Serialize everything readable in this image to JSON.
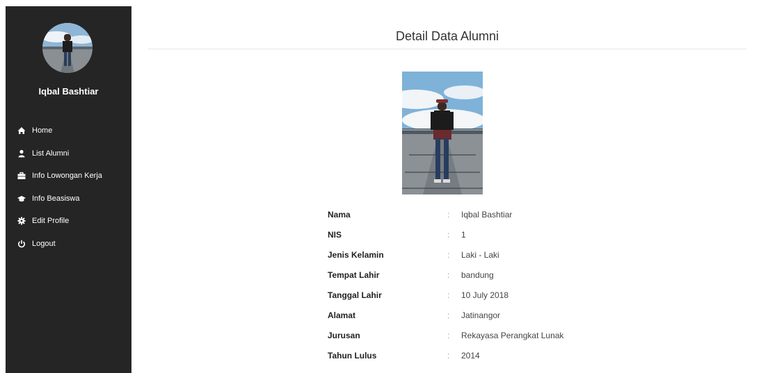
{
  "sidebar": {
    "user_name": "Iqbal Bashtiar",
    "items": [
      {
        "label": "Home",
        "icon": "home-icon"
      },
      {
        "label": "List Alumni",
        "icon": "user-icon"
      },
      {
        "label": "Info Lowongan Kerja",
        "icon": "briefcase-icon"
      },
      {
        "label": "Info Beasiswa",
        "icon": "graduation-cap-icon"
      },
      {
        "label": "Edit Profile",
        "icon": "gear-icon"
      },
      {
        "label": "Logout",
        "icon": "power-icon"
      }
    ]
  },
  "main": {
    "title": "Detail Data Alumni",
    "separator": ":",
    "details": [
      {
        "label": "Nama",
        "value": "Iqbal Bashtiar"
      },
      {
        "label": "NIS",
        "value": "1"
      },
      {
        "label": "Jenis Kelamin",
        "value": "Laki - Laki"
      },
      {
        "label": "Tempat Lahir",
        "value": "bandung"
      },
      {
        "label": "Tanggal Lahir",
        "value": "10 July 2018"
      },
      {
        "label": "Alamat",
        "value": "Jatinangor"
      },
      {
        "label": "Jurusan",
        "value": "Rekayasa Perangkat Lunak"
      },
      {
        "label": "Tahun Lulus",
        "value": "2014"
      }
    ]
  },
  "colors": {
    "sidebar_bg": "#252525",
    "sidebar_text": "#ffffff",
    "page_bg": "#ffffff"
  }
}
